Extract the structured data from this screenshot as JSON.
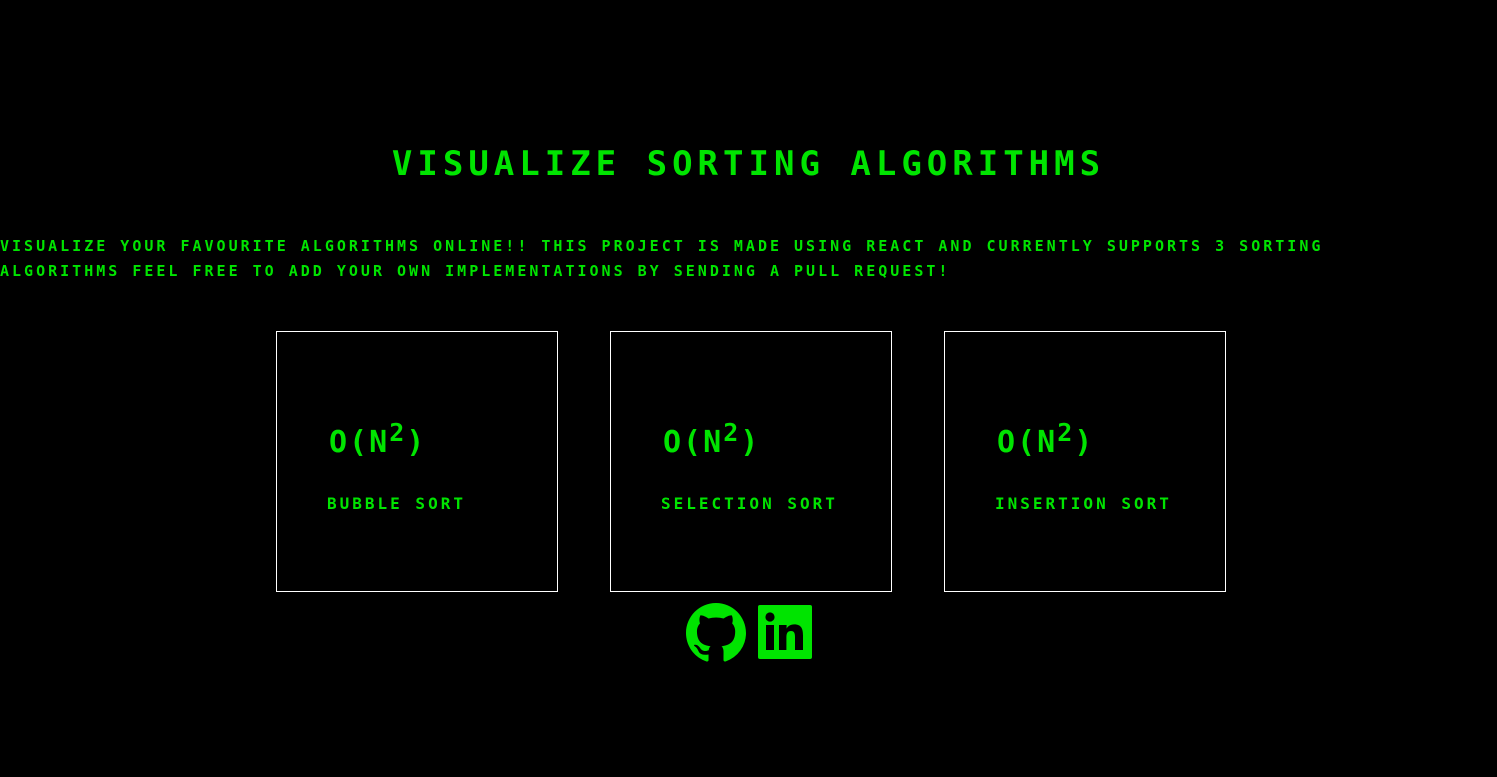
{
  "header": {
    "title": "Visualize Sorting Algorithms"
  },
  "intro": {
    "text": "Visualize your favourite algorithms online!! This project is made using React and currently supports 3 sorting algorithms feel free to add your own implementations by sending a pull request!"
  },
  "cards": [
    {
      "complexity_base": "O(N",
      "complexity_exp": "2",
      "complexity_close": ")",
      "name": "Bubble Sort"
    },
    {
      "complexity_base": "O(N",
      "complexity_exp": "2",
      "complexity_close": ")",
      "name": "Selection Sort"
    },
    {
      "complexity_base": "O(N",
      "complexity_exp": "2",
      "complexity_close": ")",
      "name": "Insertion Sort"
    }
  ],
  "social": {
    "icons": [
      "github-icon",
      "linkedin-icon"
    ]
  },
  "colors": {
    "background": "#000000",
    "accent": "#00e400",
    "card_border": "#ffffff"
  }
}
